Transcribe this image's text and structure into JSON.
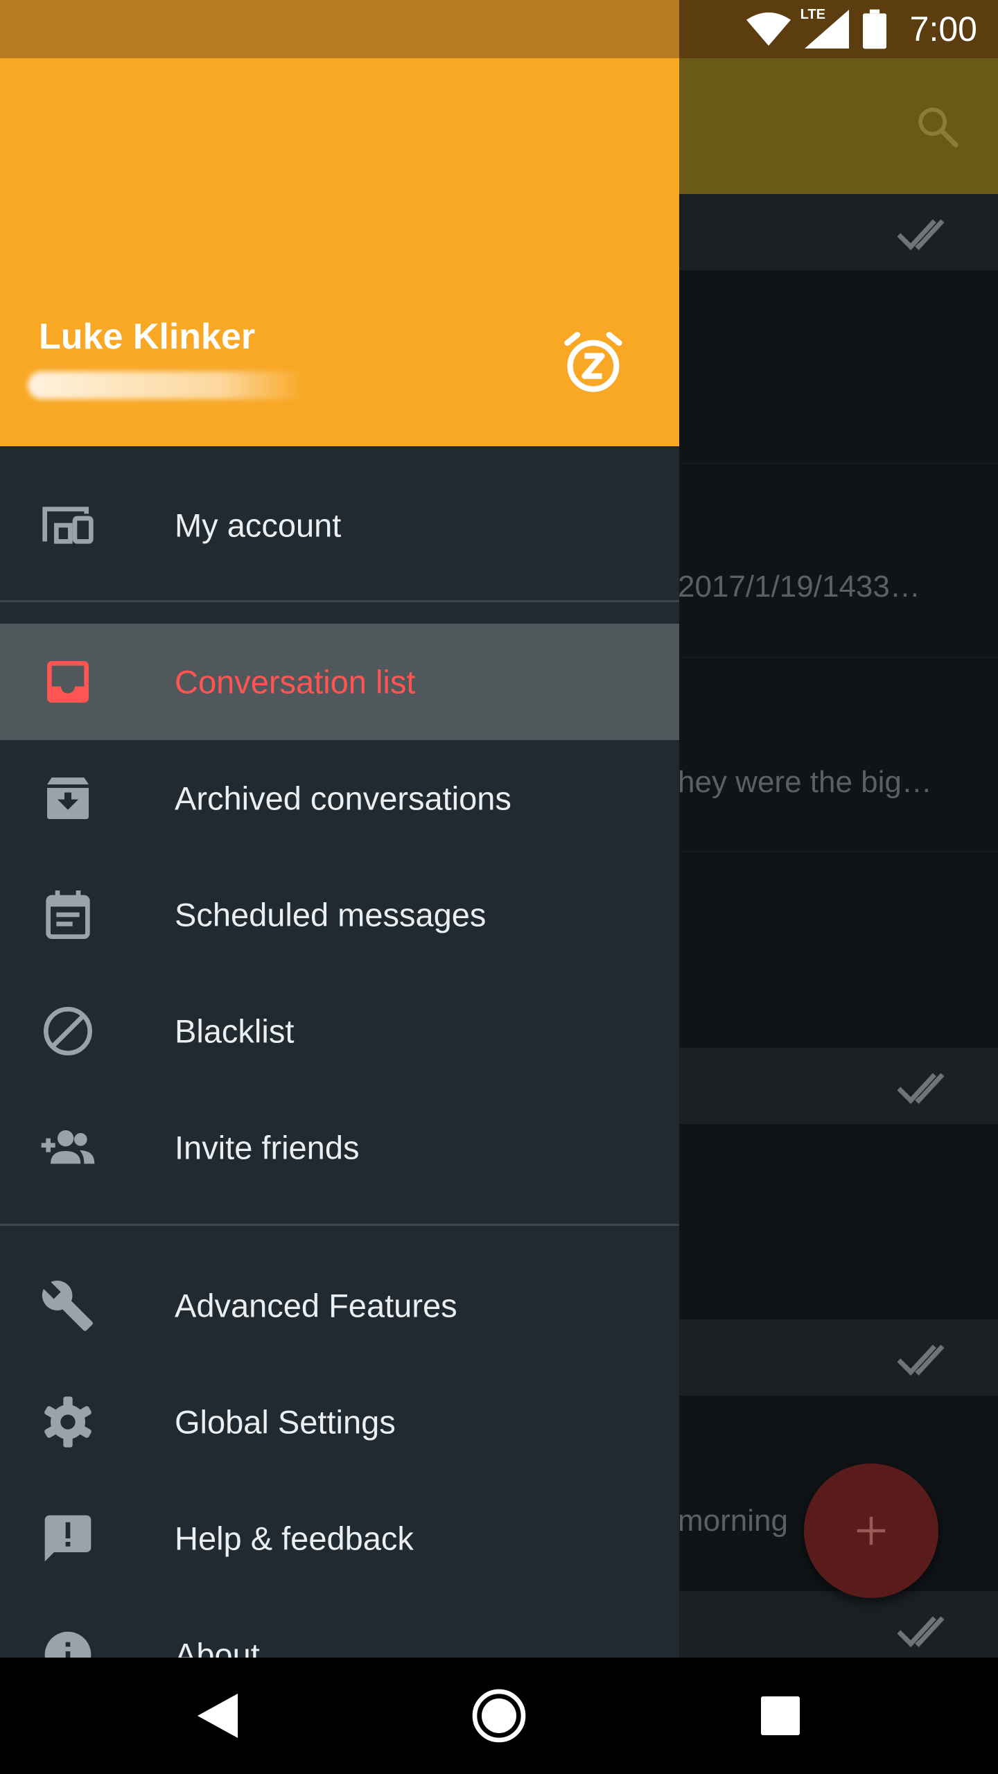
{
  "status_bar": {
    "network": "LTE",
    "time": "7:00"
  },
  "drawer": {
    "header": {
      "user_name": "Luke Klinker",
      "accent_color": "#f9a826"
    },
    "items": [
      {
        "label": "My account",
        "icon": "devices-icon"
      },
      {
        "label": "Conversation list",
        "icon": "inbox-icon",
        "active": true,
        "active_color": "#ff5552"
      },
      {
        "label": "Archived conversations",
        "icon": "archive-icon"
      },
      {
        "label": "Scheduled messages",
        "icon": "calendar-icon"
      },
      {
        "label": "Blacklist",
        "icon": "block-icon"
      },
      {
        "label": "Invite friends",
        "icon": "group-add-icon"
      },
      {
        "label": "Advanced Features",
        "icon": "wrench-icon"
      },
      {
        "label": "Global Settings",
        "icon": "gear-icon"
      },
      {
        "label": "Help & feedback",
        "icon": "feedback-icon"
      },
      {
        "label": "About",
        "icon": "info-icon"
      }
    ]
  },
  "background": {
    "snippets": [
      "2017/1/19/1433…",
      "hey were the big…",
      "morning"
    ]
  }
}
